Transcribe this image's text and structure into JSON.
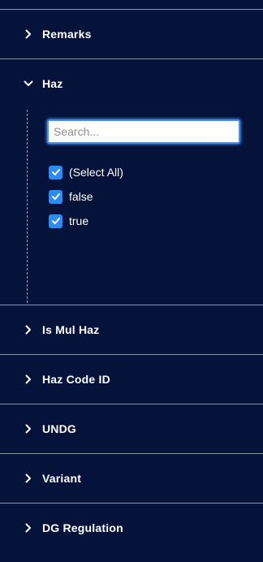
{
  "sections": [
    {
      "id": "remarks",
      "label": "Remarks",
      "expanded": false
    },
    {
      "id": "haz",
      "label": "Haz",
      "expanded": true
    },
    {
      "id": "is-mul-haz",
      "label": "Is Mul Haz",
      "expanded": false
    },
    {
      "id": "haz-code-id",
      "label": "Haz Code ID",
      "expanded": false
    },
    {
      "id": "undg",
      "label": "UNDG",
      "expanded": false
    },
    {
      "id": "variant",
      "label": "Variant",
      "expanded": false
    },
    {
      "id": "dg-regulation",
      "label": "DG Regulation",
      "expanded": false
    }
  ],
  "haz_filter": {
    "search_placeholder": "Search...",
    "search_value": "",
    "options": [
      {
        "label": "(Select All)",
        "checked": true
      },
      {
        "label": "false",
        "checked": true
      },
      {
        "label": "true",
        "checked": true
      }
    ]
  },
  "colors": {
    "background": "#05133a",
    "divider": "#8a93a8",
    "checkbox": "#2d8cf0",
    "search_focus": "#3f8ff0"
  },
  "icons": {
    "collapsed": "chevron-right-icon",
    "expanded": "chevron-down-icon",
    "checked": "checkmark-icon"
  }
}
